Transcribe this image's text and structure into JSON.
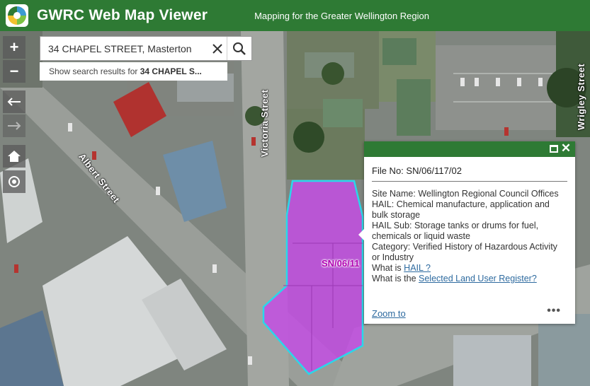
{
  "header": {
    "title": "GWRC Web Map Viewer",
    "subtitle": "Mapping for the Greater Wellington Region"
  },
  "search": {
    "value": "34 CHAPEL STREET, Masterton",
    "hint_prefix": "Show search results for",
    "hint_query": "34 CHAPEL S..."
  },
  "controls": {
    "zoom_in": "+",
    "zoom_out": "−"
  },
  "map": {
    "streets": [
      "Albert Street",
      "Victoria Street",
      "Wrigley Street"
    ],
    "parcel_label": "SN/06/11",
    "parcel_fill": "#c34ee3",
    "parcel_outline": "#2ad7ea"
  },
  "popup": {
    "title": "File No: SN/06/117/02",
    "fields": [
      {
        "label": "Site Name:",
        "value": "Wellington Regional Council Offices"
      },
      {
        "label": "HAIL:",
        "value": "Chemical manufacture, application and bulk storage"
      },
      {
        "label": "HAIL Sub:",
        "value": "Storage tanks or drums for fuel, chemicals or liquid waste"
      },
      {
        "label": "Category:",
        "value": "Verified History of Hazardous Activity or Industry"
      }
    ],
    "what_is_prefix": "What is",
    "what_is_link": "HAIL ?",
    "register_prefix": "What is the",
    "register_link": "Selected Land User Register?",
    "zoom_to": "Zoom to",
    "more": "•••"
  },
  "colors": {
    "header": "#2e7a34",
    "link": "#2d6a9f"
  }
}
